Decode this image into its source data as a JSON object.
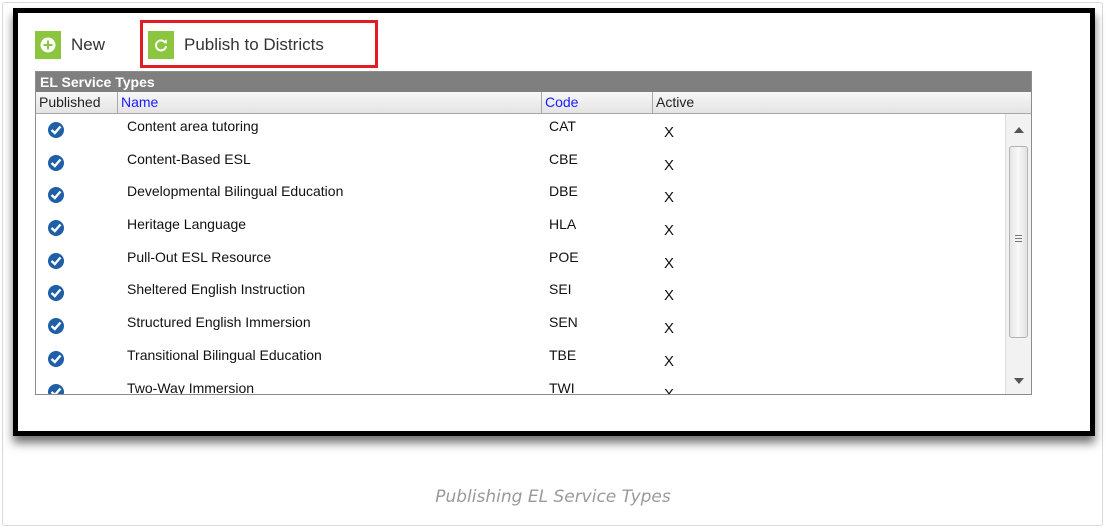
{
  "toolbar": {
    "new_label": "New",
    "publish_label": "Publish to Districts"
  },
  "grid": {
    "title": "EL Service Types",
    "columns": [
      "Published",
      "Name",
      "Code",
      "Active"
    ],
    "rows": [
      {
        "name": "Content area tutoring",
        "code": "CAT",
        "active": "X"
      },
      {
        "name": "Content-Based ESL",
        "code": "CBE",
        "active": "X"
      },
      {
        "name": "Developmental Bilingual Education",
        "code": "DBE",
        "active": "X"
      },
      {
        "name": "Heritage Language",
        "code": "HLA",
        "active": "X"
      },
      {
        "name": "Pull-Out ESL Resource",
        "code": "POE",
        "active": "X"
      },
      {
        "name": "Sheltered English Instruction",
        "code": "SEI",
        "active": "X"
      },
      {
        "name": "Structured English Immersion",
        "code": "SEN",
        "active": "X"
      },
      {
        "name": "Transitional Bilingual Education",
        "code": "TBE",
        "active": "X"
      },
      {
        "name": "Two-Way Immersion",
        "code": "TWI",
        "active": "X"
      }
    ]
  },
  "caption": "Publishing EL Service Types",
  "colors": {
    "button_green": "#8cc63f",
    "highlight_red": "#e31b23",
    "check_blue": "#1f5fa8",
    "link_blue": "#1a1aff"
  }
}
